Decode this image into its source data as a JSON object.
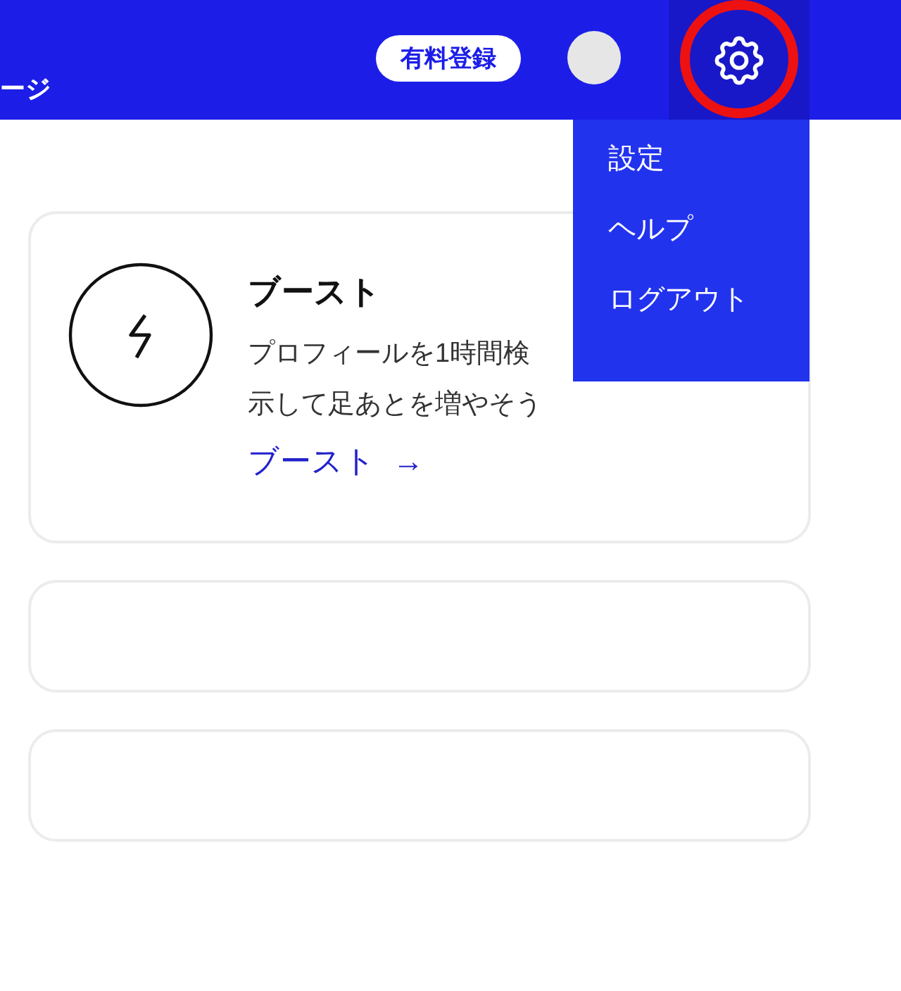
{
  "header": {
    "page_title": "ージ",
    "upgrade_badge": "有料登録",
    "settings": {
      "highlighted": true,
      "menu_open": true
    }
  },
  "menu": {
    "items": [
      {
        "label": "設定"
      },
      {
        "label": "ヘルプ"
      },
      {
        "label": "ログアウト"
      }
    ]
  },
  "cards": [
    {
      "kind": "feature",
      "title": "ブースト",
      "description_lines": [
        "プロフィールを1時間検",
        "示して足あとを増やそう"
      ],
      "link": "ブースト",
      "link_arrow": "→"
    },
    {
      "kind": "empty"
    },
    {
      "kind": "empty"
    }
  ]
}
